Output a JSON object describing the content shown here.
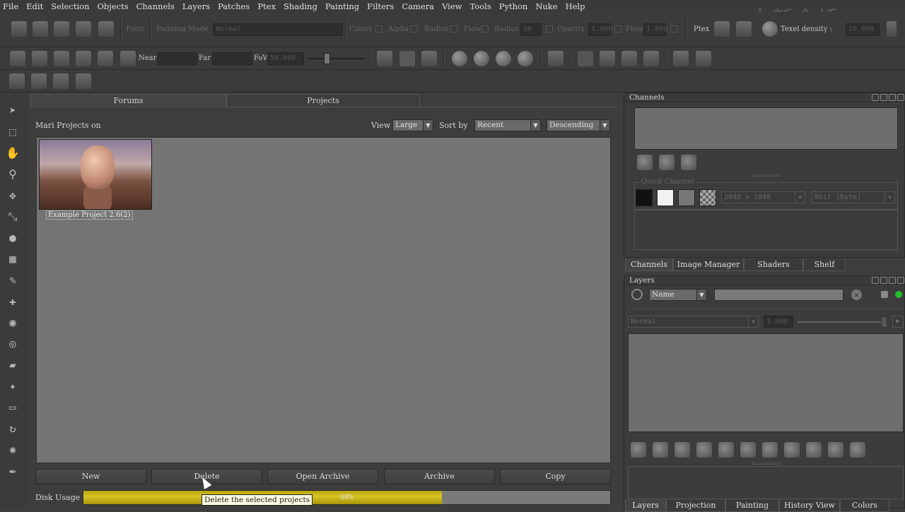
{
  "menu": [
    "File",
    "Edit",
    "Selection",
    "Objects",
    "Channels",
    "Layers",
    "Patches",
    "Ptex",
    "Shading",
    "Painting",
    "Filters",
    "Camera",
    "View",
    "Tools",
    "Python",
    "Nuke",
    "Help"
  ],
  "watermark": "中新金桥",
  "toolbar1": {
    "paint": "Paint",
    "painting_mode": "Painting Mode",
    "mode_value": "Normal",
    "colors": "Colors",
    "alpha": "Alpha",
    "radius": "Radius",
    "flow": "Flow",
    "radius2": "Radius",
    "radius_value": "30",
    "opacity": "Opacity",
    "opacity_value": "1.000",
    "flow2": "Flow",
    "flow_value": "1.000",
    "ptex": "Ptex",
    "texel_density": "Texel density :",
    "texel_value": "10.000"
  },
  "toolbar2": {
    "near": "Near",
    "far": "Far",
    "fov": "FoV",
    "fov_value": "50.000"
  },
  "tabs": {
    "forums": "Forums",
    "projects": "Projects"
  },
  "projects": {
    "title": "Mari Projects on",
    "view_label": "View",
    "view_value": "Large",
    "sort_label": "Sort by",
    "sort_value": "Recent",
    "order_value": "Descending",
    "items": [
      {
        "name": "Example Project 2.6(2)"
      }
    ],
    "buttons": {
      "new": "New",
      "delete": "Delete",
      "open_archive": "Open Archive",
      "archive": "Archive",
      "copy": "Copy"
    },
    "disk_label": "Disk Usage",
    "disk_percent": "68%",
    "disk_fraction": 0.68,
    "tooltip": "Delete the selected projects"
  },
  "channels_panel": {
    "title": "Channels",
    "quick_channel": "Quick Channel",
    "size_value": "2048 x 2048",
    "depth_value": "8bit (Byte)",
    "tabs": [
      "Channels",
      "Image Manager",
      "Shaders",
      "Shelf"
    ]
  },
  "layers_panel": {
    "title": "Layers",
    "filter_value": "Name",
    "blend_value": "Normal",
    "opacity_value": "1.000",
    "tabs": [
      "Layers",
      "Projection",
      "Painting",
      "History View",
      "Colors"
    ]
  },
  "colors": {
    "disk_fill": "#d8c424",
    "status_green": "#22c02a"
  }
}
